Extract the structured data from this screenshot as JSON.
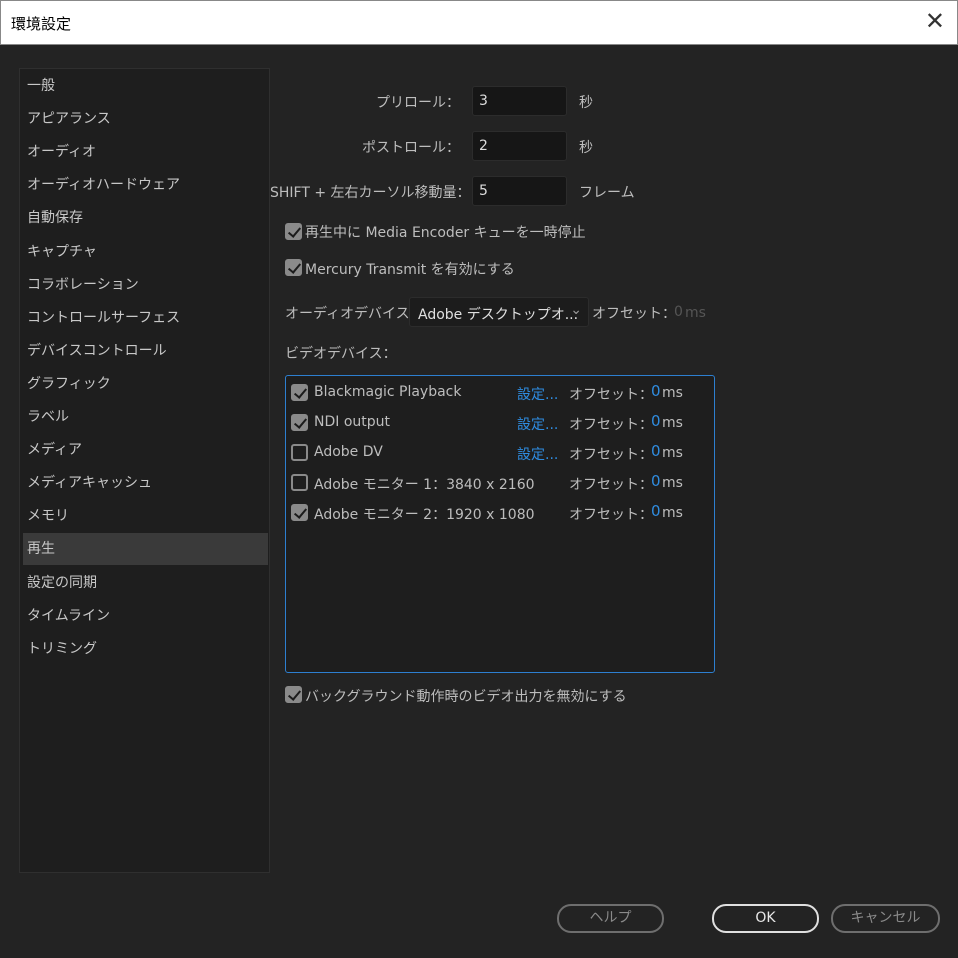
{
  "window": {
    "title": "環境設定",
    "close_icon": "close-icon"
  },
  "sidebar": {
    "selected": "再生",
    "items": [
      "一般",
      "アピアランス",
      "オーディオ",
      "オーディオハードウェア",
      "自動保存",
      "キャプチャ",
      "コラボレーション",
      "コントロールサーフェス",
      "デバイスコントロール",
      "グラフィック",
      "ラベル",
      "メディア",
      "メディアキャッシュ",
      "メモリ",
      "再生",
      "設定の同期",
      "タイムライン",
      "トリミング"
    ]
  },
  "playback": {
    "preroll": {
      "label": "プリロール：",
      "value": "3",
      "unit": "秒"
    },
    "postroll": {
      "label": "ポストロール：",
      "value": "2",
      "unit": "秒"
    },
    "shift": {
      "label": "SHIFT + 左右カーソル移動量：",
      "value": "5",
      "unit": "フレーム"
    },
    "pause_encoder": {
      "label": "再生中に Media Encoder キューを一時停止",
      "checked": true
    },
    "mercury": {
      "label": "Mercury Transmit を有効にする",
      "checked": true
    },
    "audio_device": {
      "label": "オーディオデバイス：",
      "value": "Adobe デスクトップオ...",
      "offset_label": "オフセット：",
      "offset_value": "0",
      "offset_unit": "ms"
    },
    "video_label": "ビデオデバイス：",
    "video_devices": [
      {
        "name": "Blackmagic Playback",
        "checked": true,
        "settings": "設定...",
        "offset_label": "オフセット：",
        "offset": "0",
        "unit": "ms"
      },
      {
        "name": "NDI output",
        "checked": true,
        "settings": "設定...",
        "offset_label": "オフセット：",
        "offset": "0",
        "unit": "ms"
      },
      {
        "name": "Adobe DV",
        "checked": false,
        "settings": "設定...",
        "offset_label": "オフセット：",
        "offset": "0",
        "unit": "ms"
      },
      {
        "name": "Adobe モニター 1：3840 x 2160",
        "checked": false,
        "offset_label": "オフセット：",
        "offset": "0",
        "unit": "ms"
      },
      {
        "name": "Adobe モニター 2：1920 x 1080",
        "checked": true,
        "offset_label": "オフセット：",
        "offset": "0",
        "unit": "ms"
      }
    ],
    "background": {
      "label": "バックグラウンド動作時のビデオ出力を無効にする",
      "checked": true
    }
  },
  "buttons": {
    "help": "ヘルプ",
    "ok": "OK",
    "cancel": "キャンセル"
  },
  "colors": {
    "accent": "#2f8ce0",
    "background": "#232323"
  }
}
